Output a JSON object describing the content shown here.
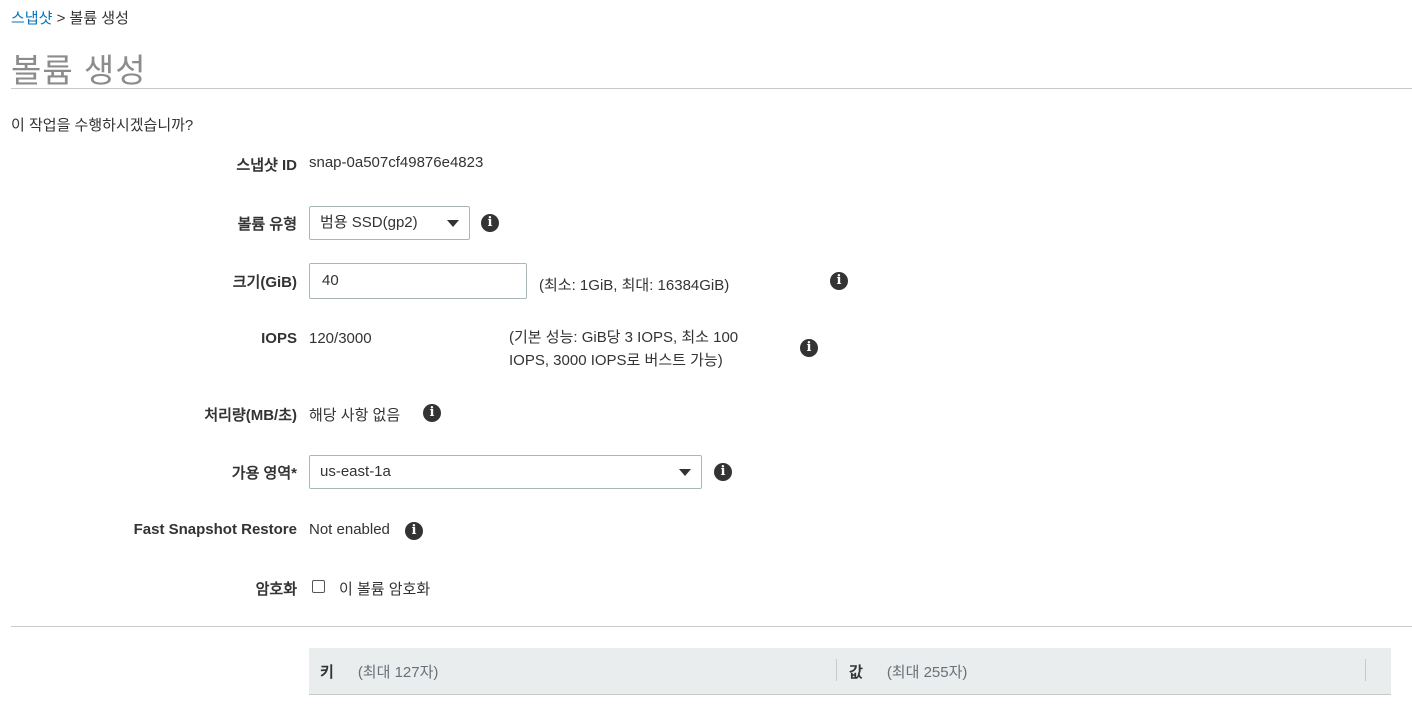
{
  "breadcrumb": {
    "parent": "스냅샷",
    "separator": ">",
    "current": "볼륨 생성"
  },
  "page_title": "볼륨 생성",
  "confirm_text": "이 작업을 수행하시겠습니까?",
  "form": {
    "snapshot_id": {
      "label": "스냅샷 ID",
      "value": "snap-0a507cf49876e4823"
    },
    "volume_type": {
      "label": "볼륨 유형",
      "value": "범용 SSD(gp2)"
    },
    "size": {
      "label": "크기(GiB)",
      "value": "40",
      "hint": "(최소: 1GiB, 최대: 16384GiB)"
    },
    "iops": {
      "label": "IOPS",
      "value": "120/3000",
      "hint_line1": "(기본 성능: GiB당 3 IOPS, 최소 100",
      "hint_line2": "IOPS, 3000 IOPS로 버스트 가능)"
    },
    "throughput": {
      "label": "처리량(MB/초)",
      "value": "해당 사항 없음"
    },
    "availability_zone": {
      "label": "가용 영역*",
      "value": "us-east-1a"
    },
    "fast_snapshot_restore": {
      "label": "Fast Snapshot Restore",
      "value": "Not enabled"
    },
    "encryption": {
      "label": "암호화",
      "checkbox_label": "이 볼륨 암호화",
      "checked": false
    }
  },
  "tags_table": {
    "key_header": "키",
    "key_hint": "(최대 127자)",
    "value_header": "값",
    "value_hint": "(최대 255자)"
  },
  "icons": {
    "info": "info-icon",
    "dropdown": "chevron-down-icon"
  },
  "colors": {
    "link": "#0073bb",
    "title": "#8c8c8c",
    "header_bg": "#eaeded"
  }
}
